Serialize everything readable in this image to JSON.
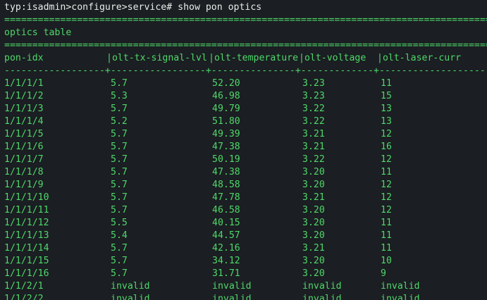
{
  "terminal": {
    "prompt": "typ:isadmin>configure>service#",
    "command": "show pon optics",
    "separator_equals": "=========================================================================================================",
    "title": "optics table",
    "separator_equals_2": "=========================================================================================================",
    "columns": [
      "pon-idx",
      "|olt-tx-signal-lvl",
      "|olt-temperature",
      "|olt-voltage",
      "|olt-laser-curr"
    ],
    "separator_dashes": "------------------+-----------------+---------------+-------------+------------------------",
    "rows": [
      [
        "1/1/1/1",
        "5.7",
        "52.20",
        "3.23",
        "11"
      ],
      [
        "1/1/1/2",
        "5.3",
        "46.98",
        "3.23",
        "15"
      ],
      [
        "1/1/1/3",
        "5.7",
        "49.79",
        "3.22",
        "13"
      ],
      [
        "1/1/1/4",
        "5.2",
        "51.80",
        "3.22",
        "13"
      ],
      [
        "1/1/1/5",
        "5.7",
        "49.39",
        "3.21",
        "12"
      ],
      [
        "1/1/1/6",
        "5.7",
        "47.38",
        "3.21",
        "16"
      ],
      [
        "1/1/1/7",
        "5.7",
        "50.19",
        "3.22",
        "12"
      ],
      [
        "1/1/1/8",
        "5.7",
        "47.38",
        "3.20",
        "11"
      ],
      [
        "1/1/1/9",
        "5.7",
        "48.58",
        "3.20",
        "12"
      ],
      [
        "1/1/1/10",
        "5.7",
        "47.78",
        "3.21",
        "12"
      ],
      [
        "1/1/1/11",
        "5.7",
        "46.58",
        "3.20",
        "12"
      ],
      [
        "1/1/1/12",
        "5.5",
        "40.15",
        "3.20",
        "11"
      ],
      [
        "1/1/1/13",
        "5.4",
        "44.57",
        "3.20",
        "11"
      ],
      [
        "1/1/1/14",
        "5.7",
        "42.16",
        "3.21",
        "11"
      ],
      [
        "1/1/1/15",
        "5.7",
        "34.12",
        "3.20",
        "10"
      ],
      [
        "1/1/1/16",
        "5.7",
        "31.71",
        "3.20",
        "9"
      ],
      [
        "1/1/2/1",
        "invalid",
        "invalid",
        "invalid",
        "invalid"
      ],
      [
        "1/1/2/2",
        "invalid",
        "invalid",
        "invalid",
        "invalid"
      ]
    ],
    "colors": {
      "background": "#1b1e22",
      "output_text": "#4ed86a",
      "prompt_text": "#e9ece8"
    }
  }
}
